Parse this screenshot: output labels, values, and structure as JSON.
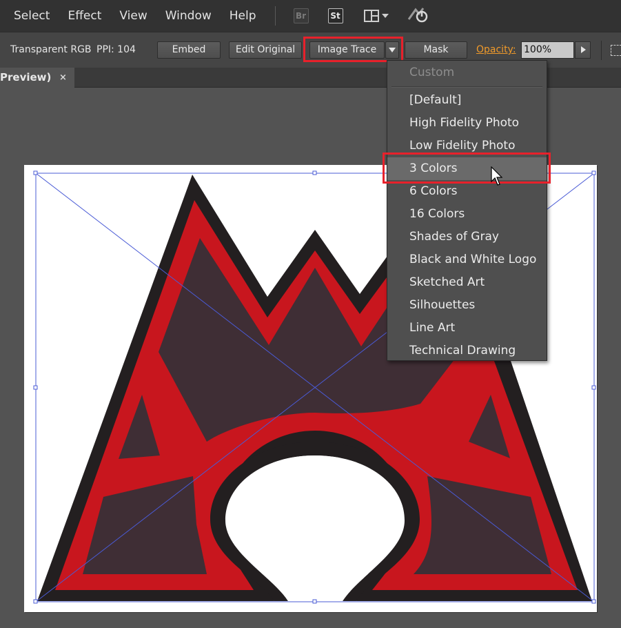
{
  "menubar": {
    "items": [
      "Select",
      "Effect",
      "View",
      "Window",
      "Help"
    ],
    "bridge_badge": "Br",
    "stock_badge": "St"
  },
  "controlbar": {
    "image_type": "Transparent RGB",
    "ppi": "PPI: 104",
    "embed_label": "Embed",
    "edit_original_label": "Edit Original",
    "image_trace_label": "Image Trace",
    "mask_label": "Mask",
    "opacity_label": "Opacity:",
    "opacity_value": "100%"
  },
  "document_tab": {
    "title": "Preview)",
    "close": "×"
  },
  "trace_presets_menu": {
    "header": "Custom",
    "items": [
      "[Default]",
      "High Fidelity Photo",
      "Low Fidelity Photo",
      "3 Colors",
      "6 Colors",
      "16 Colors",
      "Shades of Gray",
      "Black and White Logo",
      "Sketched Art",
      "Silhouettes",
      "Line Art",
      "Technical Drawing"
    ],
    "selected_index": 3
  },
  "colors": {
    "highlight": "#e8212b",
    "logo_red": "#c8161e",
    "logo_dark": "#3f2e35",
    "logo_outline": "#231f20",
    "selection": "#4a5bd6",
    "opacity_label": "#f09a2a"
  }
}
